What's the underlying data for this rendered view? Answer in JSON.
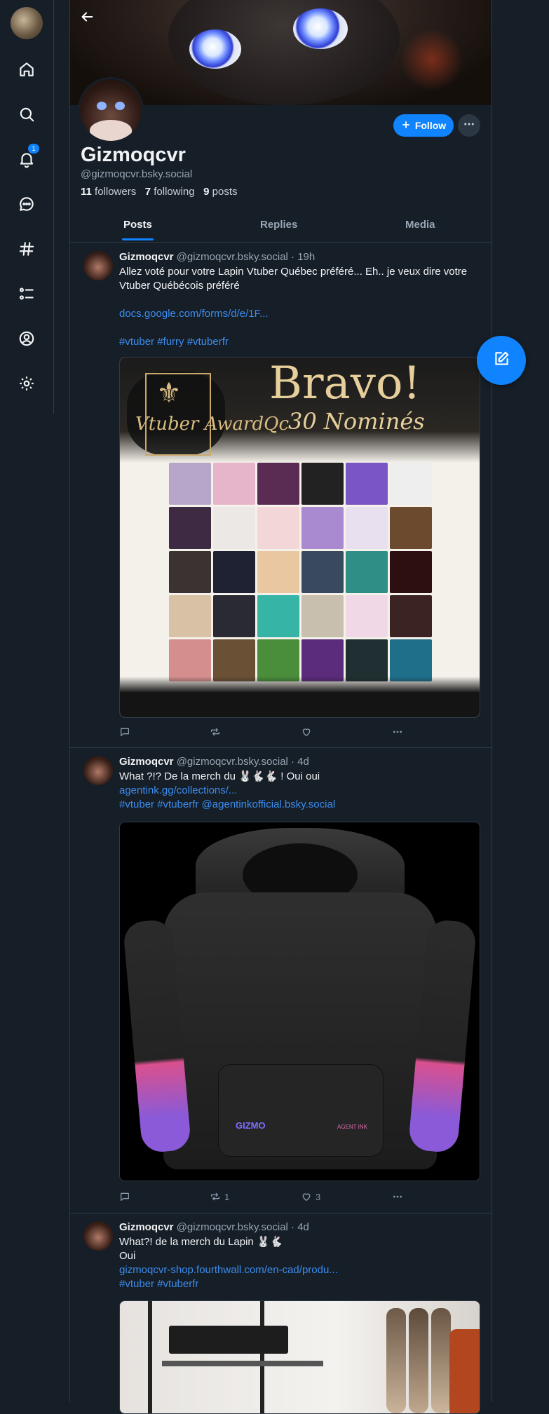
{
  "nav": {
    "notification_count": "1"
  },
  "profile": {
    "display_name": "Gizmoqcvr",
    "handle": "@gizmoqcvr.bsky.social",
    "followers_count": "11",
    "followers_label": "followers",
    "following_count": "7",
    "following_label": "following",
    "posts_count": "9",
    "posts_label": "posts",
    "follow_label": "Follow"
  },
  "tabs": [
    "Posts",
    "Replies",
    "Media"
  ],
  "posts": [
    {
      "author": "Gizmoqcvr",
      "handle": "@gizmoqcvr.bsky.social",
      "time": "· 19h",
      "text": "Allez voté pour votre Lapin Vtuber Québec préféré... Eh.. je veux dire votre Vtuber Québécois préféré",
      "link": "docs.google.com/forms/d/e/1F...",
      "tags": "#vtuber #furry #vtuberfr",
      "image": {
        "title": "Bravo!",
        "subtitle": "30 Nominés",
        "logo": "Vtuber AwardQc"
      },
      "replies": "",
      "reposts": "",
      "likes": ""
    },
    {
      "author": "Gizmoqcvr",
      "handle": "@gizmoqcvr.bsky.social",
      "time": "· 4d",
      "text": "What ?!? De la merch du 🐰🐇🐇 ! Oui oui",
      "link": "agentink.gg/collections/...",
      "tags": "#vtuber #vtuberfr @agentinkofficial.bsky.social",
      "image": {
        "left_print": "GIZMO",
        "right_print": "AGENT INK"
      },
      "replies": "",
      "reposts": "1",
      "likes": "3"
    },
    {
      "author": "Gizmoqcvr",
      "handle": "@gizmoqcvr.bsky.social",
      "time": "· 4d",
      "text": "What?! de la merch du Lapin 🐰🐇",
      "text2": "Oui",
      "link": "gizmoqcvr-shop.fourthwall.com/en-cad/produ...",
      "tags": "#vtuber #vtuberfr"
    }
  ],
  "colors": {
    "accent": "#1083fe",
    "link": "#3b8df0",
    "background": "#161e27"
  }
}
